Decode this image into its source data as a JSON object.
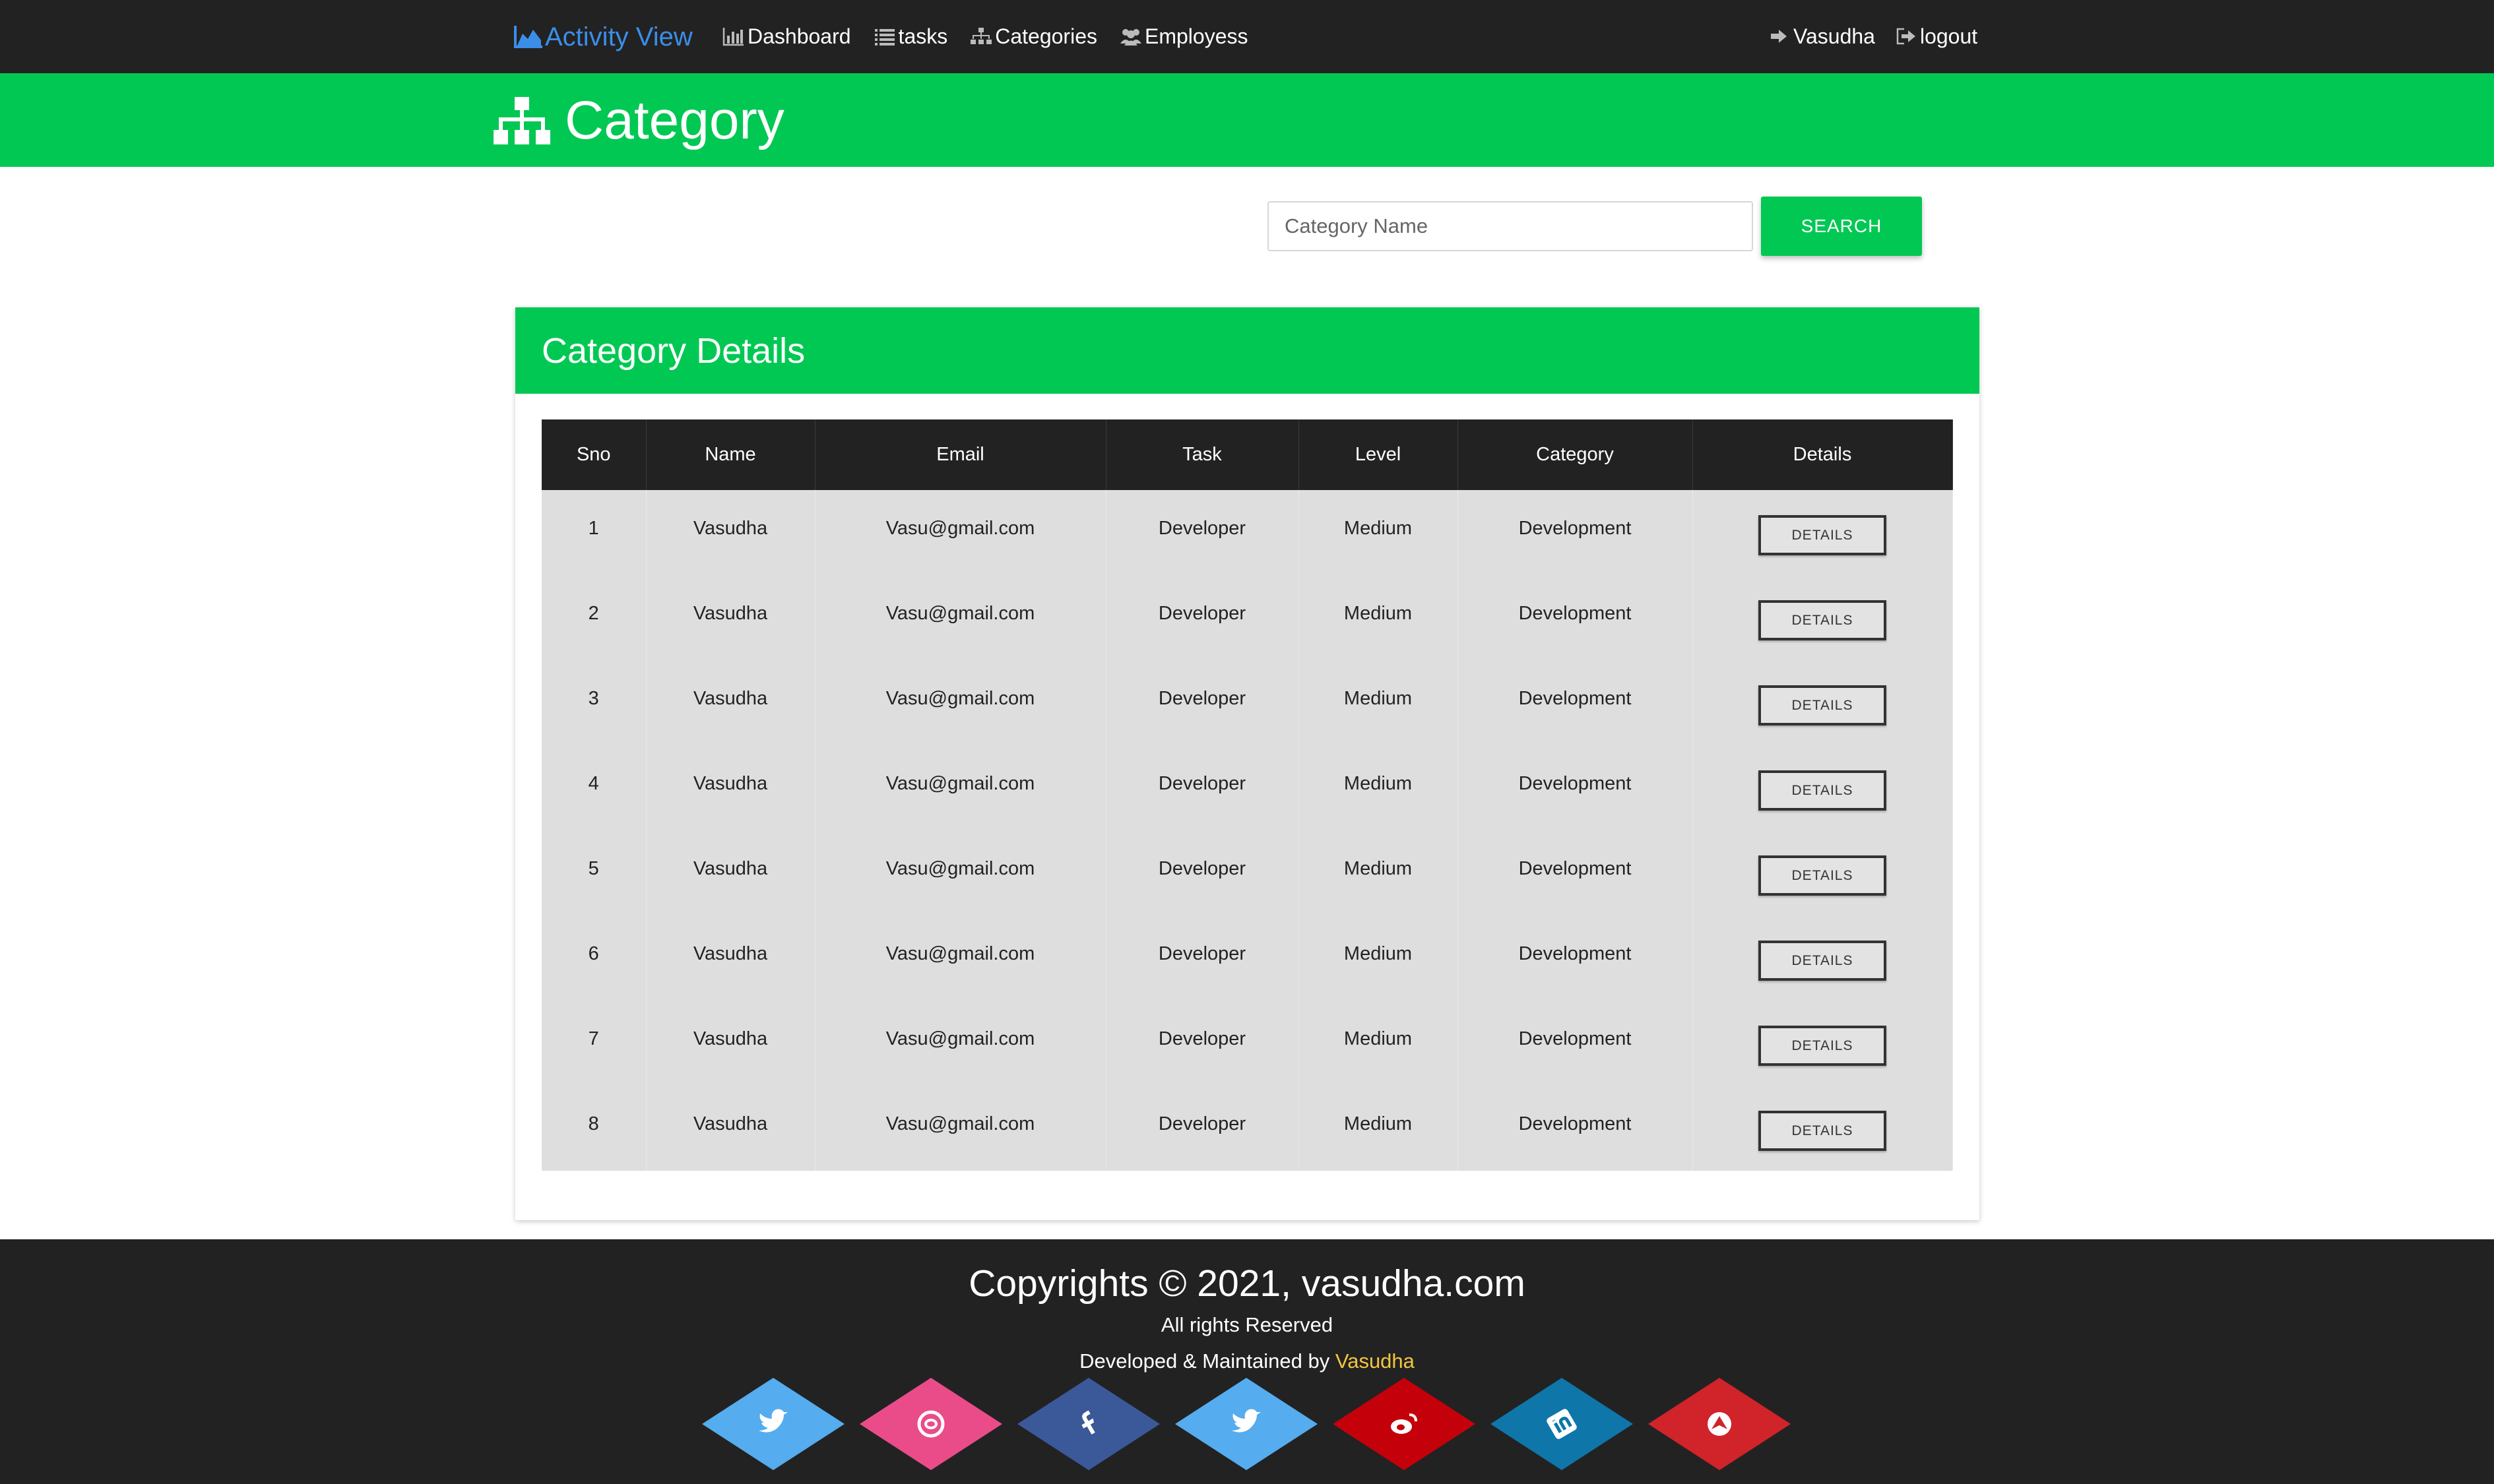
{
  "navbar": {
    "brand": "Activity View",
    "items": [
      {
        "label": "Dashboard",
        "icon": "bar-chart-icon"
      },
      {
        "label": "tasks",
        "icon": "list-icon"
      },
      {
        "label": "Categories",
        "icon": "sitemap-icon"
      },
      {
        "label": "Employess",
        "icon": "users-icon"
      }
    ],
    "user": {
      "label": "Vasudha",
      "icon": "sign-in-icon"
    },
    "logout": {
      "label": "logout",
      "icon": "sign-out-icon"
    },
    "colors": {
      "background": "#222222",
      "brand": "#3b8ee8"
    }
  },
  "header": {
    "title": "Category",
    "icon": "sitemap-icon",
    "color": "#00c853"
  },
  "search": {
    "placeholder": "Category Name",
    "value": "",
    "button_label": "SEARCH"
  },
  "card": {
    "title": "Category Details"
  },
  "table": {
    "columns": [
      "Sno",
      "Name",
      "Email",
      "Task",
      "Level",
      "Category",
      "Details"
    ],
    "rows": [
      [
        "1",
        "Vasudha",
        "Vasu@gmail.com",
        "Developer",
        "Medium",
        "Development",
        "DETAILS"
      ],
      [
        "2",
        "Vasudha",
        "Vasu@gmail.com",
        "Developer",
        "Medium",
        "Development",
        "DETAILS"
      ],
      [
        "3",
        "Vasudha",
        "Vasu@gmail.com",
        "Developer",
        "Medium",
        "Development",
        "DETAILS"
      ],
      [
        "4",
        "Vasudha",
        "Vasu@gmail.com",
        "Developer",
        "Medium",
        "Development",
        "DETAILS"
      ],
      [
        "5",
        "Vasudha",
        "Vasu@gmail.com",
        "Developer",
        "Medium",
        "Development",
        "DETAILS"
      ],
      [
        "6",
        "Vasudha",
        "Vasu@gmail.com",
        "Developer",
        "Medium",
        "Development",
        "DETAILS"
      ],
      [
        "7",
        "Vasudha",
        "Vasu@gmail.com",
        "Developer",
        "Medium",
        "Development",
        "DETAILS"
      ],
      [
        "8",
        "Vasudha",
        "Vasu@gmail.com",
        "Developer",
        "Medium",
        "Development",
        "DETAILS"
      ]
    ]
  },
  "footer": {
    "copyright": "Copyrights © 2021, vasudha.com",
    "rights": "All rights Reserved",
    "developed_prefix": "Developed & Maintained by ",
    "developed_by": "Vasudha",
    "socials": [
      {
        "icon": "twitter-icon",
        "color": "#55acee"
      },
      {
        "icon": "dribbble-icon",
        "color": "#ea4c89"
      },
      {
        "icon": "facebook-icon",
        "color": "#3b5998"
      },
      {
        "icon": "twitter-icon",
        "color": "#55acee"
      },
      {
        "icon": "weibo-icon",
        "color": "#c4000a"
      },
      {
        "icon": "linkedin-icon",
        "color": "#0e76a8"
      },
      {
        "icon": "arrow-up-icon",
        "color": "#d1232a"
      }
    ]
  }
}
